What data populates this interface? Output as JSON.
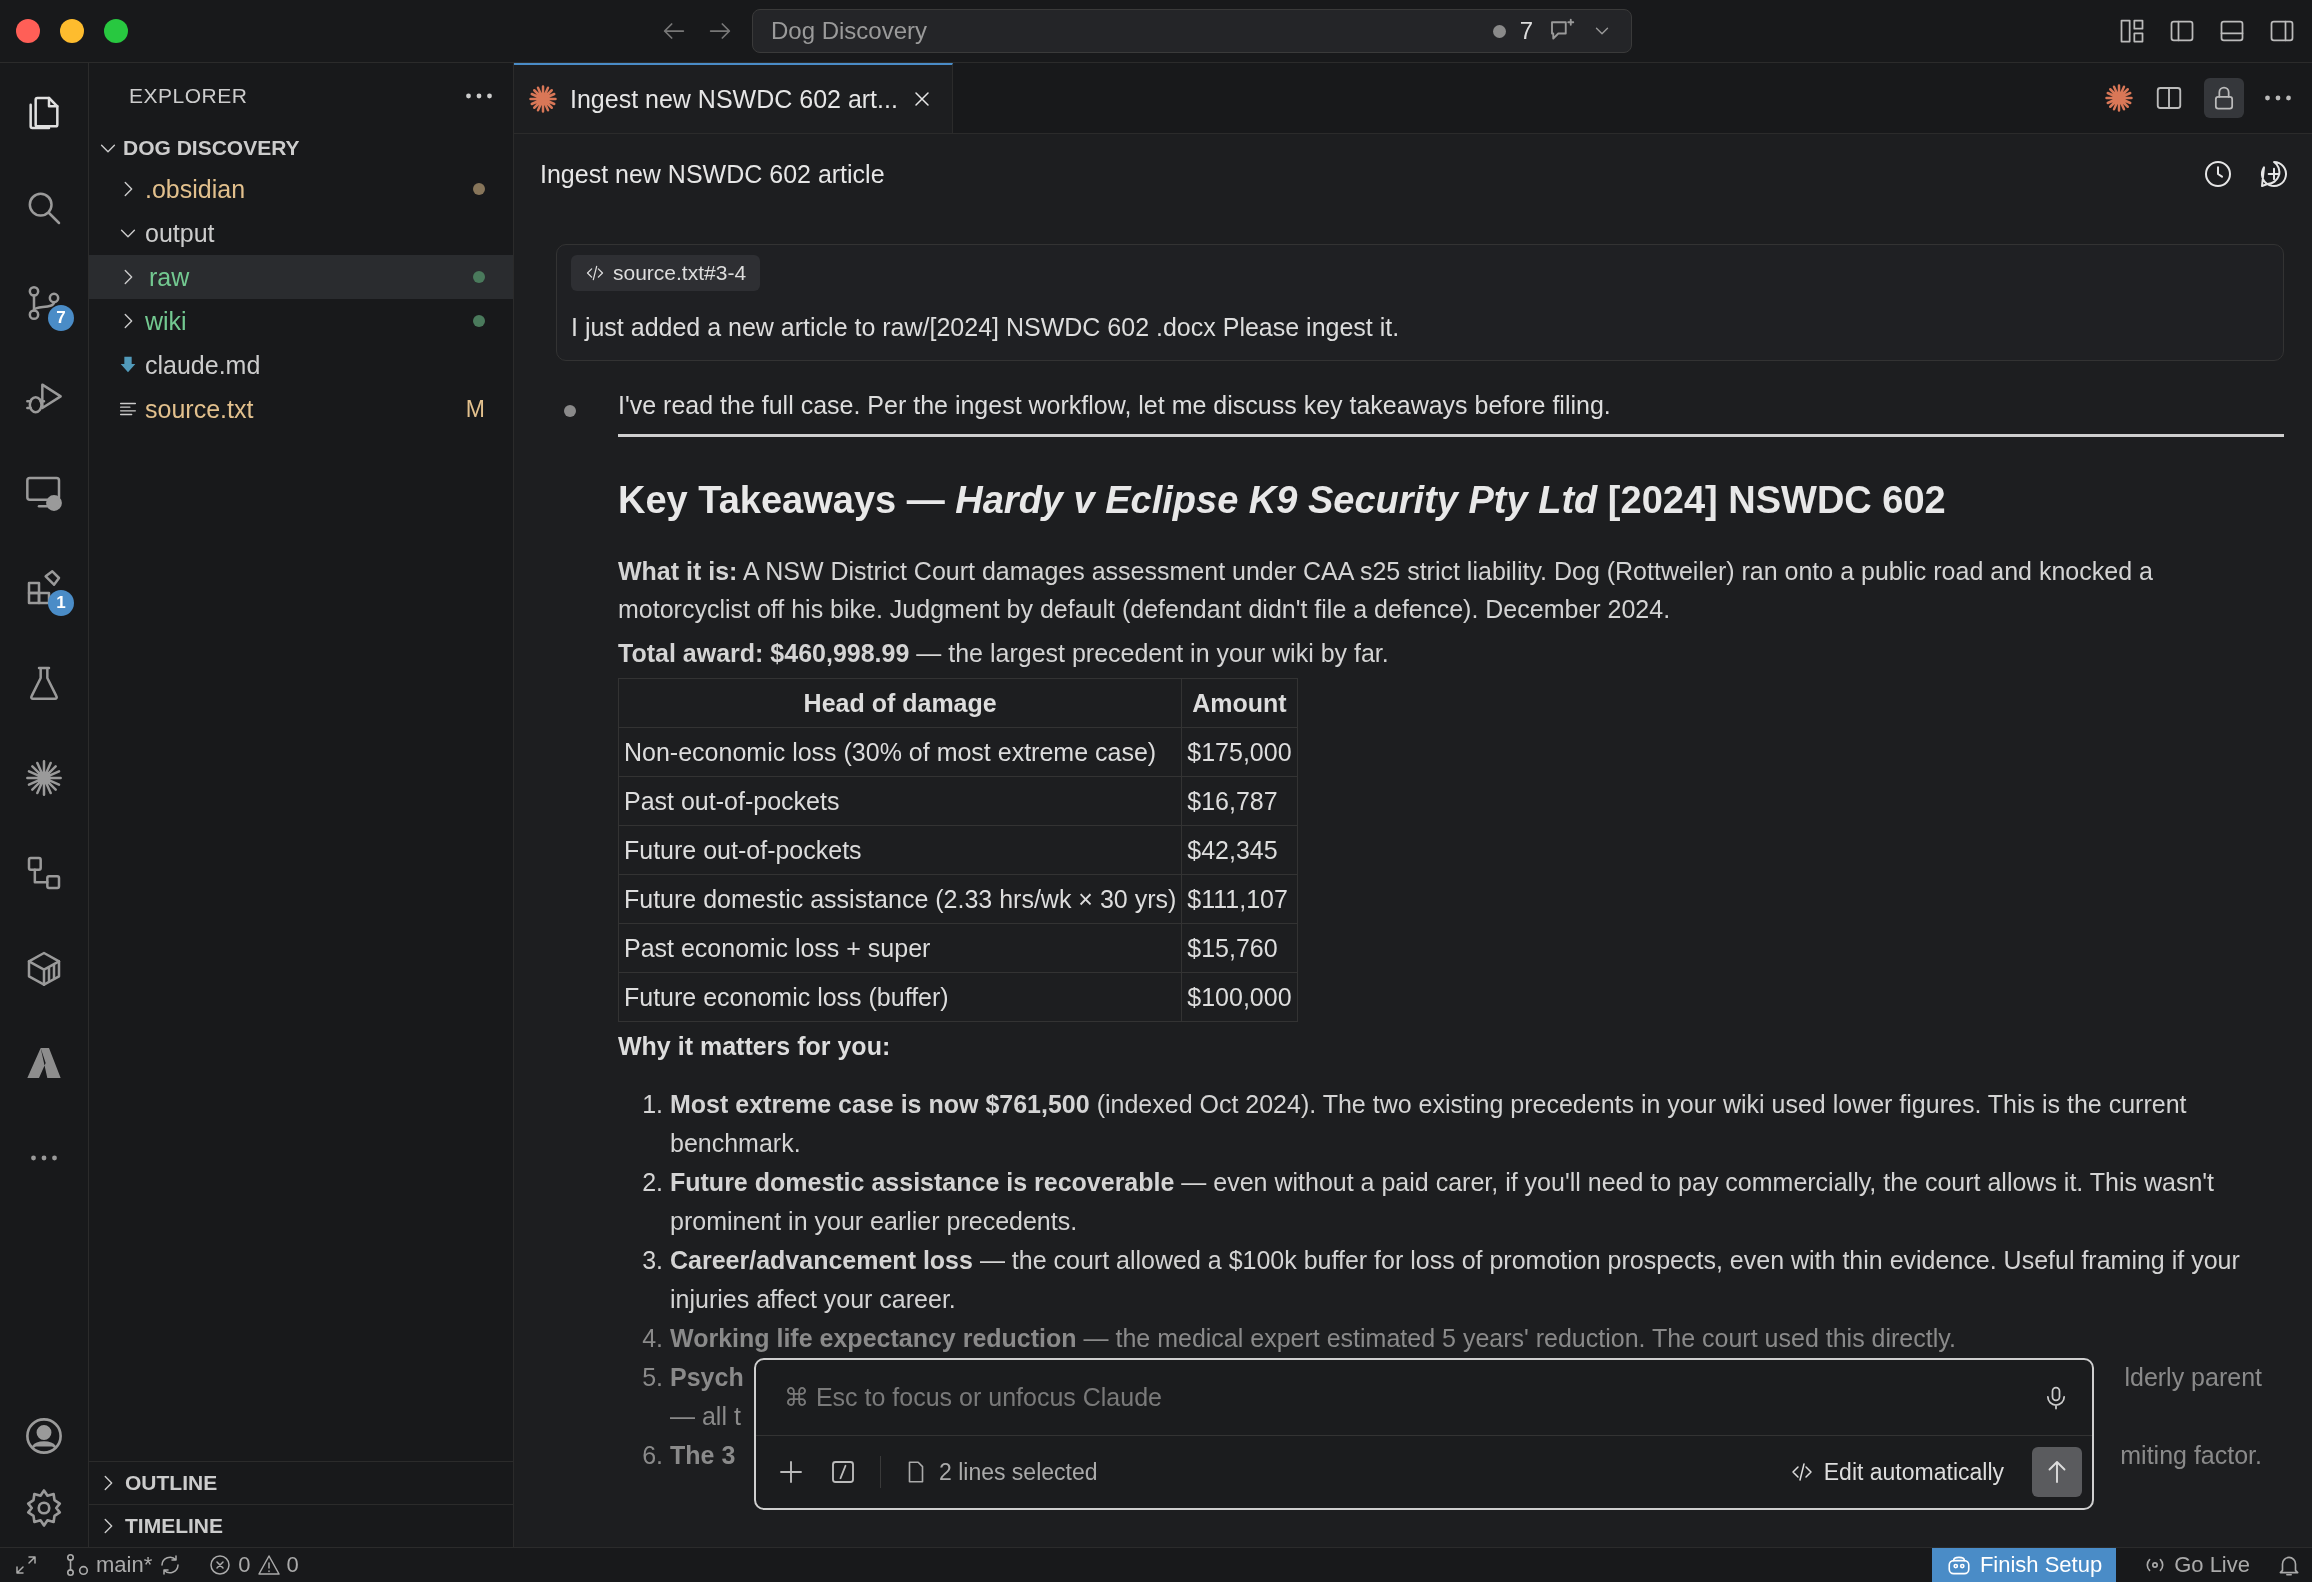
{
  "window": {
    "title": "Dog Discovery",
    "count": "7"
  },
  "activity_bar": [
    {
      "kind": "files",
      "selected": true
    },
    {
      "kind": "search",
      "selected": false
    },
    {
      "kind": "source-control",
      "selected": false,
      "badge": "7"
    },
    {
      "kind": "run",
      "selected": false
    },
    {
      "kind": "remote",
      "selected": false
    },
    {
      "kind": "extensions",
      "selected": false,
      "badge": "1"
    },
    {
      "kind": "testing",
      "selected": false
    },
    {
      "kind": "spark",
      "selected": false
    },
    {
      "kind": "flow",
      "selected": false
    },
    {
      "kind": "container",
      "selected": false
    },
    {
      "kind": "azure",
      "selected": false
    },
    {
      "kind": "more",
      "selected": false
    }
  ],
  "explorer": {
    "title": "EXPLORER",
    "root": "DOG DISCOVERY",
    "items": [
      {
        "label": ".obsidian",
        "kind": "folder",
        "expanded": false,
        "selected": false,
        "color": "#e2c08d",
        "dot": true
      },
      {
        "label": "output",
        "kind": "folder",
        "expanded": true,
        "selected": false
      },
      {
        "label": "raw",
        "kind": "folder",
        "expanded": false,
        "selected": true,
        "color": "#73c991",
        "dot": true
      },
      {
        "label": "wiki",
        "kind": "folder",
        "expanded": false,
        "selected": false,
        "color": "#73c991",
        "dot": true
      },
      {
        "label": "claude.md",
        "kind": "markdown",
        "selected": false
      },
      {
        "label": "source.txt",
        "kind": "text",
        "selected": false,
        "color": "#e2c08d",
        "badge": "M"
      }
    ],
    "sections": [
      {
        "label": "OUTLINE",
        "expanded": false
      },
      {
        "label": "TIMELINE",
        "expanded": false
      }
    ]
  },
  "tabs": [
    {
      "label": "Ingest new NSWDC 602 art...",
      "selected": true
    }
  ],
  "chat": {
    "title": "Ingest new NSWDC 602 article",
    "user_message": {
      "attachment": "source.txt#3-4",
      "text": "I just added a new article to raw/[2024] NSWDC 602 .docx Please ingest it."
    },
    "intro": "I've read the full case. Per the ingest workflow, let me discuss key takeaways before filing.",
    "heading": "Key Takeaways — *Hardy v Eclipse K9 Security Pty Ltd* [2024] NSWDC 602",
    "paragraphs": [
      "**What it is:** A NSW District Court damages assessment under CAA s25 strict liability. Dog (Rottweiler) ran onto a public road and knocked a motorcyclist off his bike. Judgment by default (defendant didn't file a defence). December 2024.",
      "**Total award: $460,998.99** — the largest precedent in your wiki by far."
    ],
    "table": {
      "columns": [
        "Head of damage",
        "Amount"
      ],
      "rows": [
        [
          "Non-economic loss (30% of most extreme case)",
          "$175,000"
        ],
        [
          "Past out-of-pockets",
          "$16,787"
        ],
        [
          "Future out-of-pockets",
          "$42,345"
        ],
        [
          "Future domestic assistance (2.33 hrs/wk × 30 yrs)",
          "$111,107"
        ],
        [
          "Past economic loss + super",
          "$15,760"
        ],
        [
          "Future economic loss (buffer)",
          "$100,000"
        ]
      ]
    },
    "subheading": "Why it matters for you:",
    "list": [
      {
        "number": "1.",
        "text": "**Most extreme case is now $761,500** (indexed Oct 2024). The two existing precedents in your wiki used lower figures. This is the current benchmark."
      },
      {
        "number": "2.",
        "text": "**Future domestic assistance is recoverable** — even without a paid carer, if you'll need to pay commercially, the court allows it. This wasn't prominent in your earlier precedents."
      },
      {
        "number": "3.",
        "text": "**Career/advancement loss** — the court allowed a $100k buffer for loss of promotion prospects, even with thin evidence. Useful framing if your injuries affect your career."
      },
      {
        "number": "4.",
        "text": "**Working life expectancy reduction** — the medical expert estimated 5 years' reduction. The court used this directly."
      },
      {
        "number": "5.",
        "left": "**Psych**",
        "right": "lderly parent",
        "more": "— all t"
      },
      {
        "number": "6.",
        "left": "**The 3**",
        "right": "miting factor."
      }
    ],
    "input": {
      "placeholder": "⌘ Esc to focus or unfocus Claude",
      "selection": "2 lines selected",
      "mode": "Edit automatically"
    }
  },
  "status_bar": {
    "branch": "main*",
    "errors": "0",
    "warnings": "0",
    "setup": "Finish Setup",
    "live": "Go Live"
  }
}
